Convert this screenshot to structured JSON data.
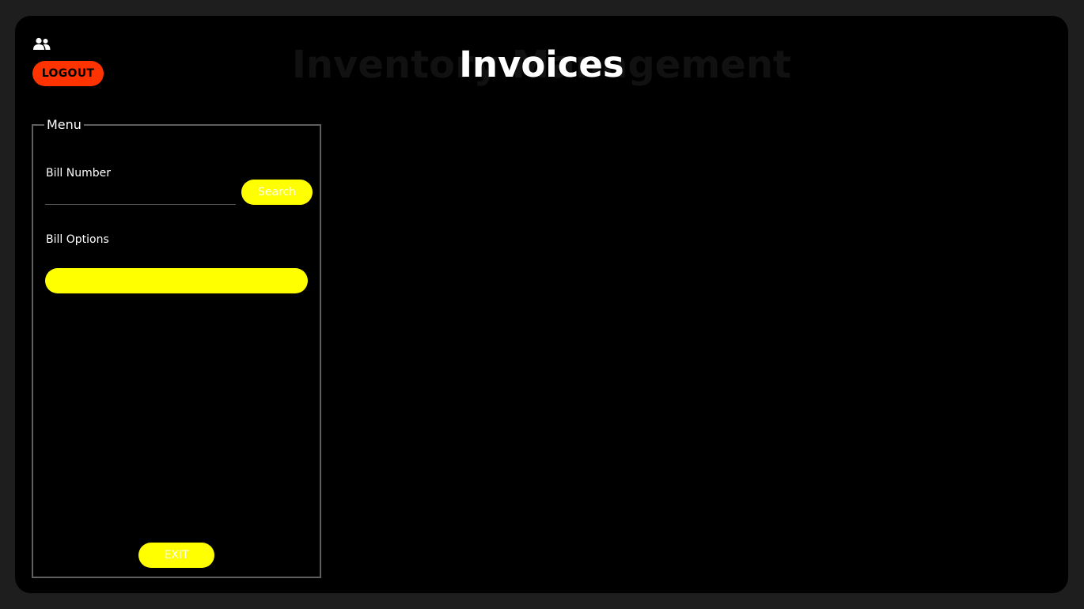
{
  "header": {
    "title": "Invoices",
    "background_title": "Inventory Management",
    "logout_label": "LOGOUT",
    "user_icon": "users-icon"
  },
  "menu": {
    "legend": "Menu",
    "bill_number_label": "Bill Number",
    "bill_number_value": "",
    "search_label": "Search",
    "bill_options_label": "Bill Options",
    "bill_options_selected": "",
    "exit_label": "EXIT"
  },
  "colors": {
    "logout": "#ff3300",
    "accent": "#ffff00",
    "background": "#000000"
  }
}
